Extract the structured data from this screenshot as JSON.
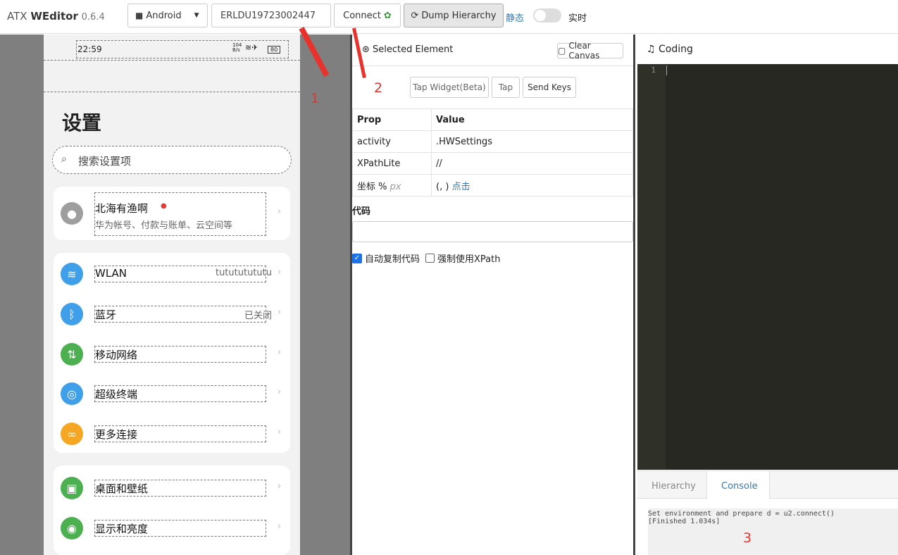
{
  "app": {
    "brand_prefix": "ATX ",
    "brand_name": "WEditor",
    "version": "0.6.4"
  },
  "toolbar": {
    "platform": "Android",
    "device_serial": "ERLDU19723002447",
    "connect_label": "Connect",
    "dump_label": "Dump Hierarchy",
    "mode_static": "静态",
    "mode_realtime": "实时"
  },
  "phone": {
    "status_time": "22:59",
    "status_speed": "104 B/s",
    "battery": "80",
    "title": "设置",
    "search_placeholder": "搜索设置项",
    "account": {
      "name": "北海有渔啊",
      "subtitle": "华为帐号、付款与账单、云空间等"
    },
    "items": [
      {
        "label": "WLAN",
        "value": "tutututututu",
        "icon": "wifi-icon",
        "color": "#3f9fe8"
      },
      {
        "label": "蓝牙",
        "value": "已关闭",
        "icon": "bluetooth-icon",
        "color": "#3f9fe8"
      },
      {
        "label": "移动网络",
        "value": "",
        "icon": "mobile-network-icon",
        "color": "#4caf50"
      },
      {
        "label": "超级终端",
        "value": "",
        "icon": "super-device-icon",
        "color": "#3f9fe8"
      },
      {
        "label": "更多连接",
        "value": "",
        "icon": "link-icon",
        "color": "#f5a623"
      },
      {
        "label": "桌面和壁纸",
        "value": "",
        "icon": "wallpaper-icon",
        "color": "#4caf50"
      },
      {
        "label": "显示和亮度",
        "value": "",
        "icon": "eye-icon",
        "color": "#4caf50"
      }
    ]
  },
  "inspector": {
    "title": "Selected Element",
    "clear_canvas": "Clear Canvas",
    "actions": [
      "Tap Widget(Beta)",
      "Tap",
      "Send Keys"
    ],
    "headers": {
      "prop": "Prop",
      "value": "Value"
    },
    "rows": [
      {
        "prop": "activity",
        "value": ".HWSettings"
      },
      {
        "prop": "XPathLite",
        "value": "//"
      }
    ],
    "coord_prop": "坐标 %",
    "coord_unit": "px",
    "coord_value": "(, )",
    "coord_link": "点击",
    "code_label": "代码",
    "auto_copy": "自动复制代码",
    "force_xpath": "强制使用XPath"
  },
  "coding": {
    "title": "Coding",
    "line_no": "1"
  },
  "bottom_tabs": {
    "hierarchy": "Hierarchy",
    "console": "Console"
  },
  "console": {
    "line1": "Set environment and prepare d = u2.connect()",
    "line2": "[Finished 1.034s]"
  },
  "annotations": {
    "a1": "1",
    "a2": "2",
    "a3": "3"
  },
  "colors": {
    "accent": "#337ab7",
    "annotation": "#e8322b",
    "editor_bg": "#272822"
  }
}
